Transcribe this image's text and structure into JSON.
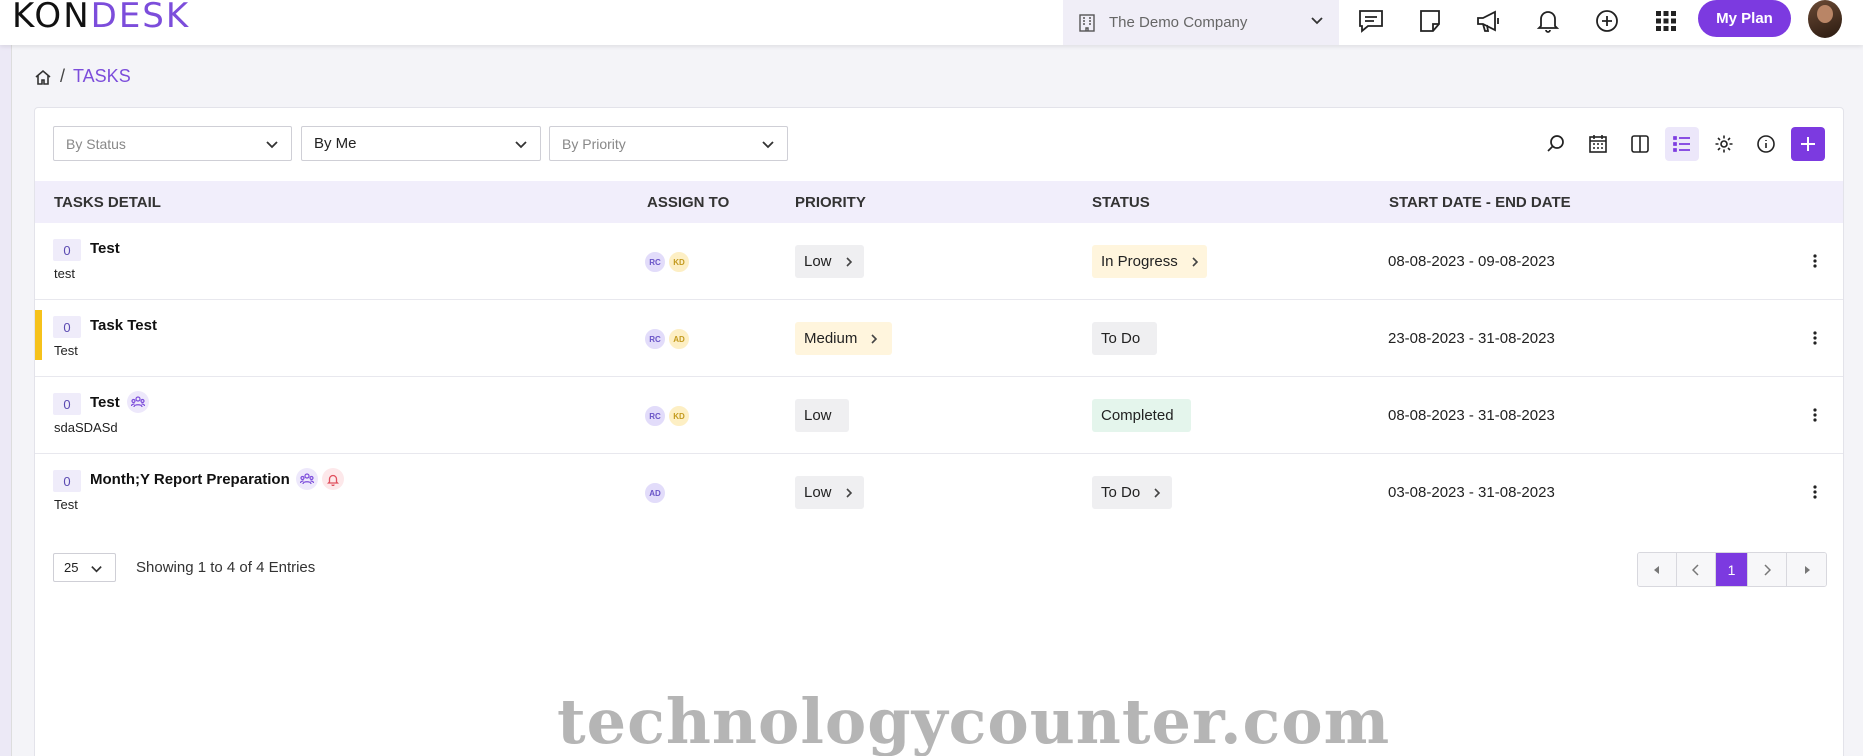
{
  "app": {
    "logo_prefix": "KON",
    "logo_suffix": "DESK"
  },
  "topbar": {
    "company": "The Demo Company",
    "my_plan": "My Plan",
    "icons": [
      "chat-icon",
      "note-icon",
      "megaphone-icon",
      "bell-icon",
      "plus-circle-icon",
      "apps-grid-icon"
    ]
  },
  "breadcrumb": {
    "current": "TASKS",
    "separator": "/"
  },
  "filters": {
    "status": "By Status",
    "assigned": "By Me",
    "priority": "By Priority"
  },
  "table": {
    "headers": {
      "detail": "TASKS DETAIL",
      "assign": "ASSIGN TO",
      "priority": "PRIORITY",
      "status": "STATUS",
      "dates": "START DATE - END DATE"
    },
    "rows": [
      {
        "count": "0",
        "title": "Test",
        "sub": "test",
        "assignees": [
          "RC",
          "KD"
        ],
        "priority": "Low",
        "status": "In Progress",
        "dates": "08-08-2023 - 09-08-2023"
      },
      {
        "count": "0",
        "title": "Task Test",
        "sub": "Test",
        "assignees": [
          "RC",
          "AD"
        ],
        "priority": "Medium",
        "status": "To Do",
        "dates": "23-08-2023 - 31-08-2023"
      },
      {
        "count": "0",
        "title": "Test",
        "sub": "sdaSDASd",
        "assignees": [
          "RC",
          "KD"
        ],
        "priority": "Low",
        "status": "Completed",
        "dates": "08-08-2023 - 31-08-2023"
      },
      {
        "count": "0",
        "title": "Month;Y Report Preparation",
        "sub": "Test",
        "assignees": [
          "AD"
        ],
        "priority": "Low",
        "status": "To Do",
        "dates": "03-08-2023 - 31-08-2023"
      }
    ]
  },
  "footer": {
    "page_size": "25",
    "showing": "Showing 1 to 4 of 4 Entries",
    "current_page": "1"
  },
  "watermark": "technologycounter.com",
  "colors": {
    "accent": "#7c3ae0",
    "flag": "#f6c21b"
  }
}
